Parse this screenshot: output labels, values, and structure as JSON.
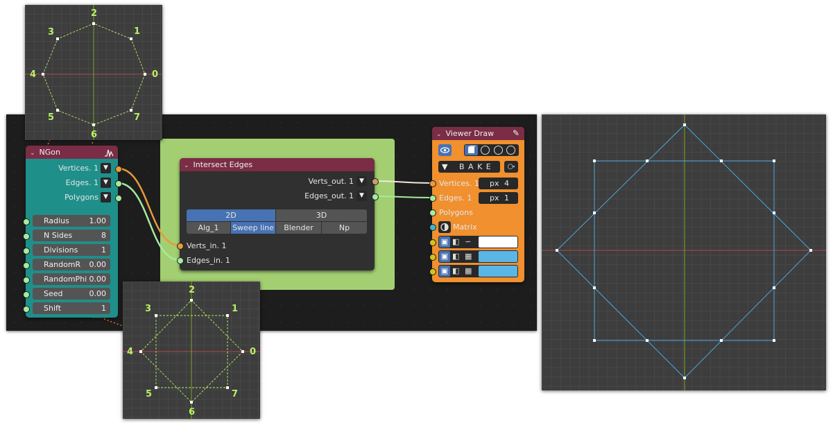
{
  "ngon": {
    "title": "NGon",
    "outputs": [
      "Vertices. 1",
      "Edges. 1",
      "Polygons"
    ],
    "params": [
      {
        "label": "Radius",
        "value": "1.00"
      },
      {
        "label": "N Sides",
        "value": "8"
      },
      {
        "label": "Divisions",
        "value": "1"
      },
      {
        "label": "RandomR",
        "value": "0.00"
      },
      {
        "label": "RandomPhi",
        "value": "0.00"
      },
      {
        "label": "Seed",
        "value": "0.00"
      },
      {
        "label": "Shift",
        "value": "1"
      }
    ]
  },
  "intersect": {
    "title": "Intersect Edges",
    "outputs": [
      "Verts_out. 1",
      "Edges_out. 1"
    ],
    "mode_tabs": [
      "2D",
      "3D"
    ],
    "algorithms": [
      "Alg_1",
      "Sweep line",
      "Blender",
      "Np"
    ],
    "inputs": [
      "Verts_in. 1",
      "Edges_in. 1"
    ]
  },
  "viewer": {
    "title": "Viewer Draw",
    "bake_label": "B A K E",
    "inputs": [
      "Vertices. 1",
      "Edges. 1",
      "Polygons",
      "Matrix"
    ],
    "vert_size_prefix": "px",
    "vert_size": "4",
    "edge_width_prefix": "px",
    "edge_width": "1",
    "colors": {
      "vertex": "#ffffff",
      "edge": "#5ab6e6",
      "polygon": "#5ab6e6"
    }
  },
  "insets": {
    "top_labels": [
      "2",
      "3",
      "1",
      "4",
      "0",
      "5",
      "7",
      "6"
    ],
    "bottom_labels": [
      "2",
      "3",
      "1",
      "4",
      "0",
      "5",
      "7",
      "6"
    ]
  },
  "colors": {
    "node_header": "#7a2d45",
    "ngon_body": "#1f8f8a",
    "viewer_body": "#f0902e",
    "frame": "#a3cf72",
    "link_orange": "#e89a3c",
    "link_green": "#a6eaa0",
    "vertex_label": "#b8f06a",
    "result_edges": "#4aa7e0"
  }
}
